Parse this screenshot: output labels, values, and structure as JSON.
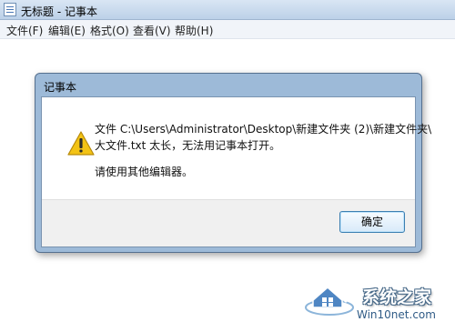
{
  "window": {
    "title": "无标题 - 记事本"
  },
  "menu": {
    "items": [
      {
        "label": "文件(F)"
      },
      {
        "label": "编辑(E)"
      },
      {
        "label": "格式(O)"
      },
      {
        "label": "查看(V)"
      },
      {
        "label": "帮助(H)"
      }
    ]
  },
  "dialog": {
    "title": "记事本",
    "message_line1": "文件 C:\\Users\\Administrator\\Desktop\\新建文件夹 (2)\\新建文件夹\\",
    "message_line2": "大文件.txt 太长，无法用记事本打开。",
    "hint": "请使用其他编辑器。",
    "ok_label": "确定",
    "icon": "warning-icon"
  },
  "watermark": {
    "brand": "系统之家",
    "url": "Win10net.com"
  },
  "colors": {
    "titlebar": "#c9dbef",
    "dialog_frame": "#9dbad8",
    "warning": "#f3c315",
    "button_border": "#3c7fb1"
  }
}
